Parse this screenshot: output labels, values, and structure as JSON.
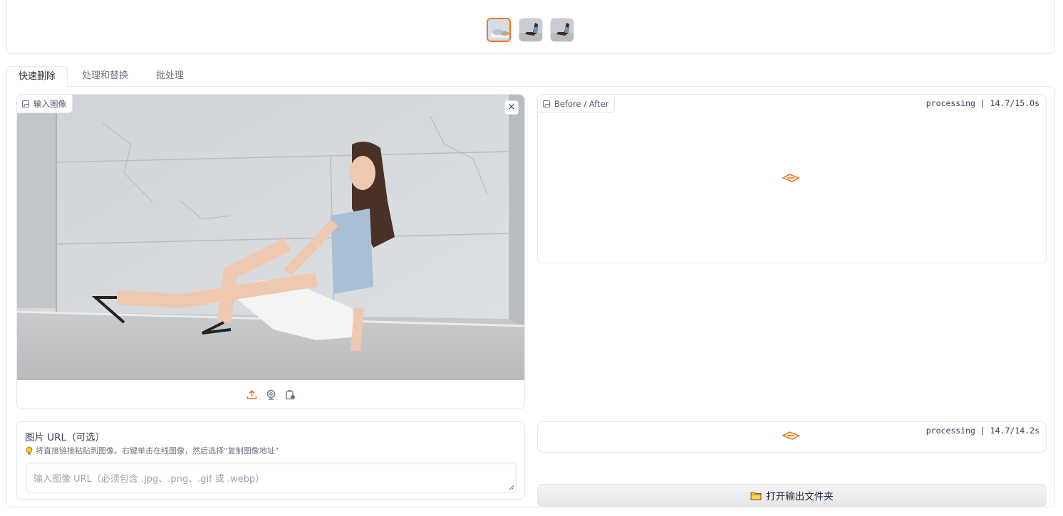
{
  "gallery": {
    "thumbnails": [
      {
        "name": "thumb-1",
        "selected": true
      },
      {
        "name": "thumb-2",
        "selected": false
      },
      {
        "name": "thumb-3",
        "selected": false
      }
    ]
  },
  "tabs": [
    {
      "label": "快速删除",
      "active": true
    },
    {
      "label": "处理和替换",
      "active": false
    },
    {
      "label": "批处理",
      "active": false
    }
  ],
  "input_image": {
    "label": "输入图像",
    "close_glyph": "×",
    "source_icons": [
      "upload-icon",
      "webcam-icon",
      "clipboard-icon"
    ]
  },
  "before_after": {
    "label": "Before / After",
    "status": "processing | 14.7/15.0s"
  },
  "output_status": {
    "status": "processing | 14.7/14.2s"
  },
  "url_section": {
    "title": "图片 URL（可选）",
    "info_icon": "lightbulb-icon",
    "info": "将直接链接粘贴到图像。右键单击在线图像，然后选择“复制图像地址”",
    "placeholder": "输入图像 URL（必须包含 .jpg、.png、.gif 或 .webp）"
  },
  "open_folder": {
    "icon": "folder-icon",
    "label": "打开输出文件夹"
  },
  "colors": {
    "accent": "#f97316",
    "border": "#e5e7eb"
  }
}
